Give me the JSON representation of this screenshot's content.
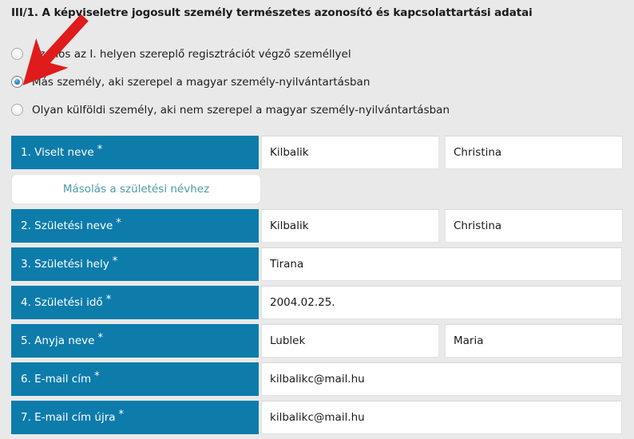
{
  "section": {
    "title": "III/1. A képviseletre jogosult személy természetes azonosító és kapcsolattartási adatai"
  },
  "radio_group": {
    "name": "kepviselo-tipus",
    "options": [
      {
        "label": "Azonos az I. helyen szereplő regisztrációt végző személlyel",
        "checked": false
      },
      {
        "label": "Más személy, aki szerepel a magyar személy-nyilvántartásban",
        "checked": true
      },
      {
        "label": "Olyan külföldi személy, aki nem szerepel a magyar személy-nyilvántartásban",
        "checked": false
      }
    ]
  },
  "copy_button": {
    "label": "Másolás a születési névhez"
  },
  "form": {
    "required_marker": "*",
    "rows": [
      {
        "label": "1. Viselt neve",
        "required": true,
        "fields": [
          {
            "value": "Kilbalik",
            "placeholder": ""
          },
          {
            "value": "Christina",
            "placeholder": ""
          }
        ]
      },
      {
        "label": "2. Születési neve",
        "required": true,
        "fields": [
          {
            "value": "Kilbalik",
            "placeholder": ""
          },
          {
            "value": "Christina",
            "placeholder": ""
          }
        ]
      },
      {
        "label": "3. Születési hely",
        "required": true,
        "fields": [
          {
            "value": "Tirana",
            "placeholder": ""
          }
        ]
      },
      {
        "label": "4. Születési idő",
        "required": true,
        "fields": [
          {
            "value": "2004.02.25.",
            "placeholder": ""
          }
        ]
      },
      {
        "label": "5. Anyja neve",
        "required": true,
        "fields": [
          {
            "value": "Lublek",
            "placeholder": ""
          },
          {
            "value": "Maria",
            "placeholder": ""
          }
        ]
      },
      {
        "label": "6. E-mail cím",
        "required": true,
        "fields": [
          {
            "value": "kilbalikc@mail.hu",
            "placeholder": ""
          }
        ]
      },
      {
        "label": "7. E-mail cím újra",
        "required": true,
        "fields": [
          {
            "value": "kilbalikc@mail.hu",
            "placeholder": ""
          }
        ]
      }
    ]
  },
  "annotation": {
    "type": "arrow",
    "color": "#e01b1b",
    "points_to": "radio-option-2"
  },
  "colors": {
    "label_blue": "#0d7cab",
    "page_background": "#e9e9e9",
    "button_text": "#4a9aa8",
    "annotation_red": "#e01b1b"
  }
}
